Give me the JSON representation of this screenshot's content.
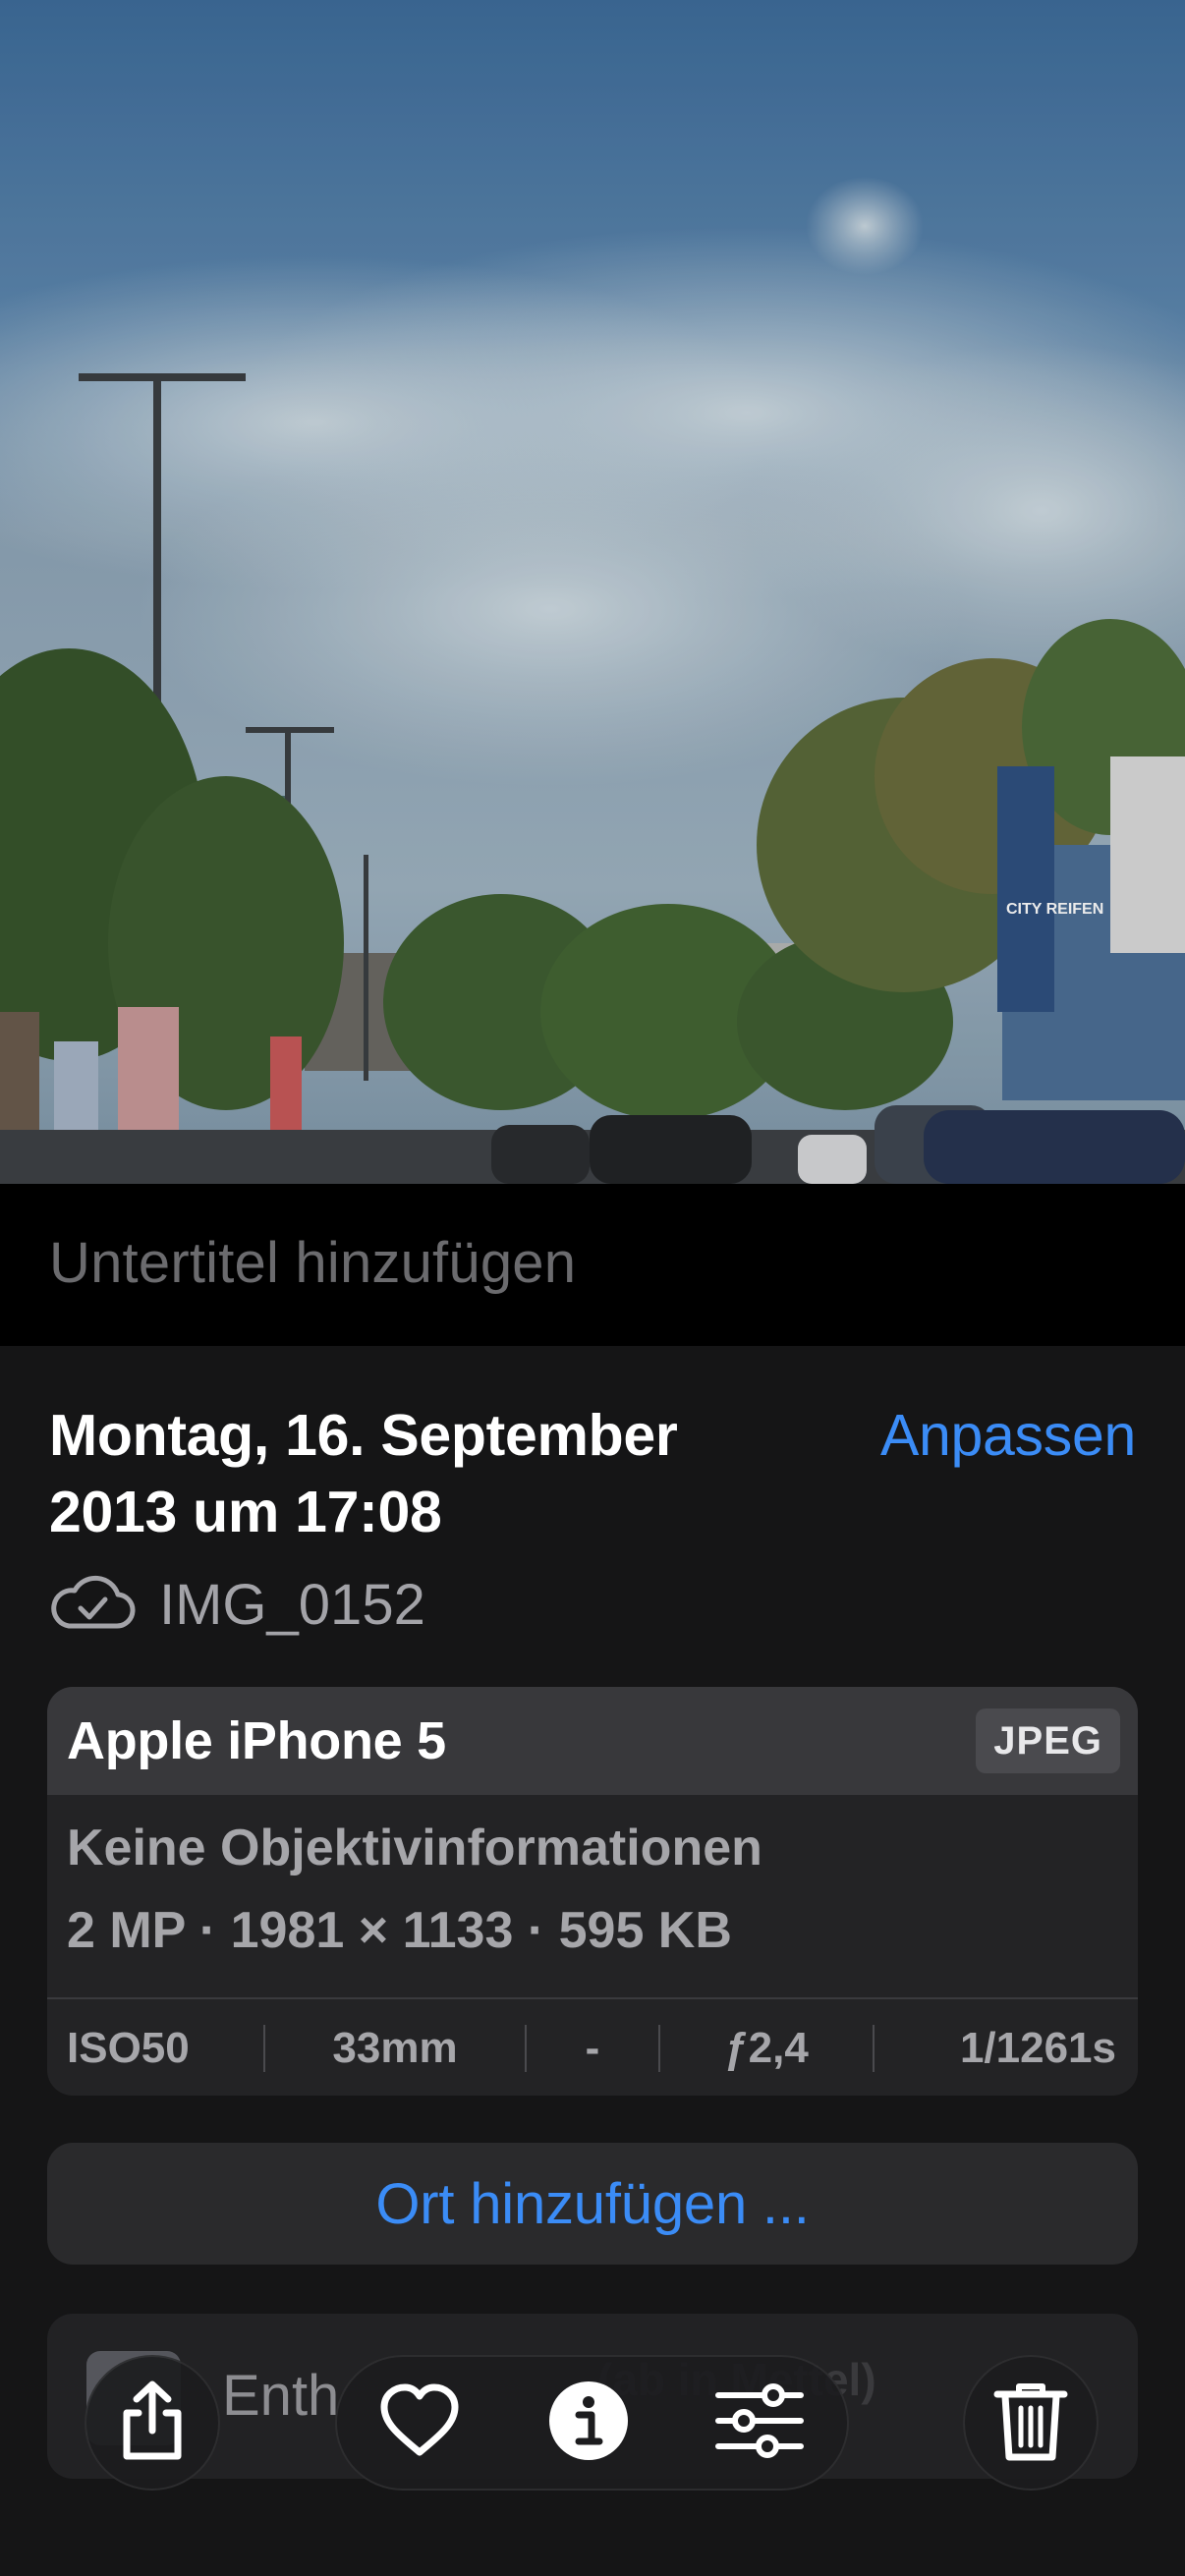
{
  "caption": {
    "placeholder": "Untertitel hinzufügen"
  },
  "info": {
    "date_line1": "Montag, 16. September",
    "date_line2": "2013 um 17:08",
    "adjust_label": "Anpassen",
    "filename": "IMG_0152",
    "cloud_icon": "icloud-check-icon"
  },
  "camera": {
    "model": "Apple iPhone 5",
    "format": "JPEG",
    "lens": "Keine Objektivinformationen",
    "specs": "2 MP · 1981 × 1133 · 595 KB",
    "exif": [
      "ISO50",
      "33mm",
      "-",
      "ƒ2,4",
      "1/1261s"
    ]
  },
  "location": {
    "label": "Ort hinzufügen ..."
  },
  "partial_card": {
    "text": "Enth",
    "ghost": "(ab in Mettel)"
  },
  "toolbar": {
    "share_icon": "share-icon",
    "favorite_icon": "heart-icon",
    "info_icon": "info-icon",
    "adjust_icon": "sliders-icon",
    "delete_icon": "trash-icon"
  },
  "photo": {
    "storefront_sign": "CITY REIFEN",
    "colors": {
      "sky_top": "#3f6e9e",
      "cloud": "#c6d3da",
      "trees": "#3c5a2f"
    }
  }
}
